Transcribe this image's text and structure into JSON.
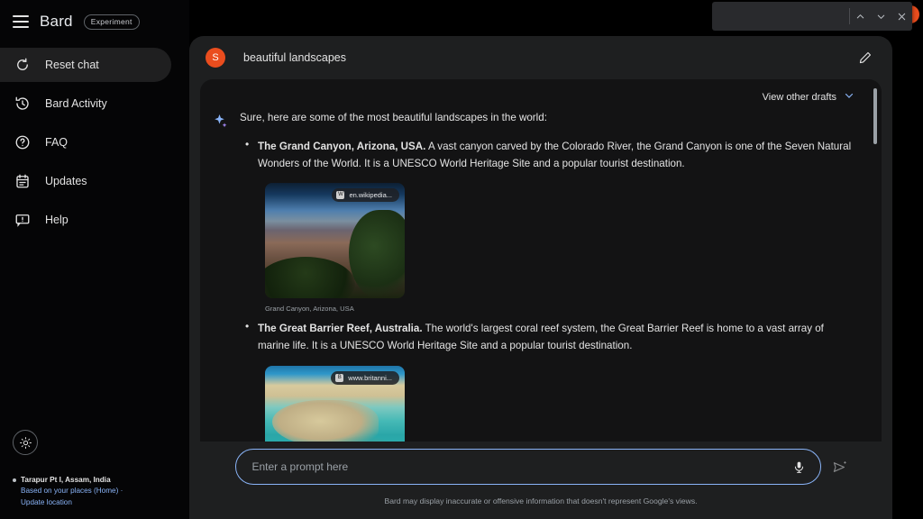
{
  "brand": {
    "title": "Bard",
    "badge": "Experiment",
    "menu_icon": "hamburger-menu-icon"
  },
  "sidebar": {
    "items": [
      {
        "label": "Reset chat",
        "icon": "refresh-icon",
        "active": true
      },
      {
        "label": "Bard Activity",
        "icon": "history-icon",
        "active": false
      },
      {
        "label": "FAQ",
        "icon": "help-circle-icon",
        "active": false
      },
      {
        "label": "Updates",
        "icon": "calendar-icon",
        "active": false
      },
      {
        "label": "Help",
        "icon": "help-book-icon",
        "active": false
      }
    ],
    "theme_toggle_icon": "brightness-icon",
    "location": {
      "place": "Tarapur Pt I, Assam, India",
      "based_on": "Based on your places (Home) ·",
      "update_link": "Update location"
    }
  },
  "find_bar": {
    "value": "",
    "placeholder": "",
    "prev_icon": "chevron-up-icon",
    "next_icon": "chevron-down-icon",
    "close_icon": "close-icon"
  },
  "chat": {
    "user_initial": "S",
    "prompt": "beautiful landscapes",
    "edit_icon": "pencil-icon",
    "drafts_label": "View other drafts",
    "drafts_icon": "chevron-down-icon",
    "bard_icon": "bard-sparkle-icon",
    "intro": "Sure, here are some of the most beautiful landscapes in the world:",
    "items": [
      {
        "title": "The Grand Canyon, Arizona, USA.",
        "text": " A vast canyon carved by the Colorado River, the Grand Canyon is one of the Seven Natural Wonders of the World. It is a UNESCO World Heritage Site and a popular tourist destination.",
        "image": {
          "source_label": "en.wikipedia...",
          "favicon_letter": "W",
          "caption": "Grand Canyon, Arizona, USA"
        }
      },
      {
        "title": "The Great Barrier Reef, Australia.",
        "text": " The world's largest coral reef system, the Great Barrier Reef is home to a vast array of marine life. It is a UNESCO World Heritage Site and a popular tourist destination.",
        "image": {
          "source_label": "www.britanni...",
          "favicon_letter": "B",
          "caption": ""
        }
      }
    ]
  },
  "composer": {
    "placeholder": "Enter a prompt here",
    "value": "",
    "mic_icon": "microphone-icon",
    "send_icon": "send-icon",
    "disclaimer": "Bard may display inaccurate or offensive information that doesn't represent Google's views."
  },
  "colors": {
    "accent_blue": "#8ab4f8",
    "avatar_orange": "#ea4d1e",
    "panel_bg": "#1e1f20",
    "card_bg": "#131314",
    "page_bg": "#000000"
  }
}
